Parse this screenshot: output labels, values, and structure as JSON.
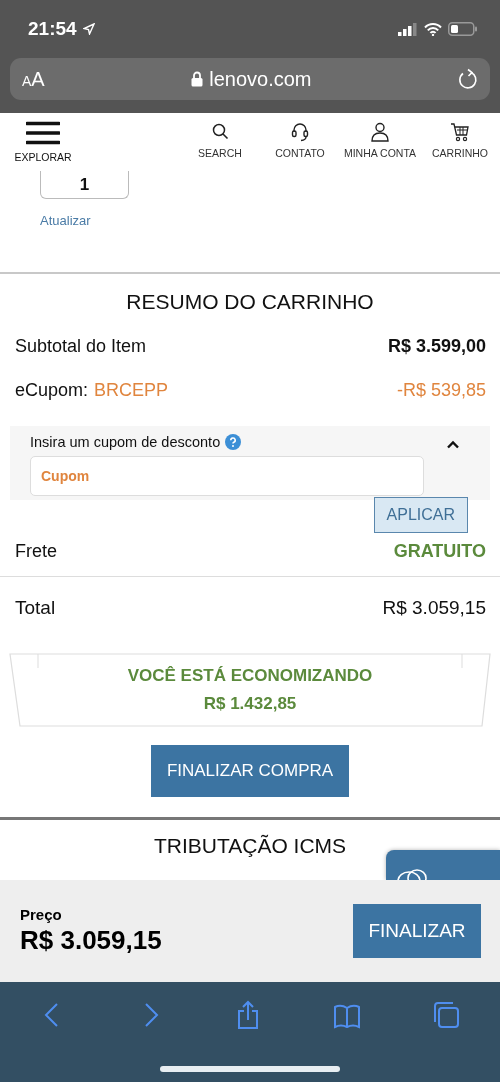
{
  "status_bar": {
    "time": "21:54"
  },
  "browser": {
    "text_size": "AA",
    "url": "lenovo.com"
  },
  "nav": {
    "menu_label": "EXPLORAR",
    "items": [
      {
        "label": "SEARCH"
      },
      {
        "label": "CONTATO"
      },
      {
        "label": "MINHA CONTA"
      },
      {
        "label": "CARRINHO"
      }
    ]
  },
  "quantity": {
    "value": "1",
    "update_link": "Atualizar"
  },
  "summary": {
    "title": "RESUMO DO CARRINHO",
    "subtotal": {
      "label": "Subtotal do Item",
      "value": "R$ 3.599,00"
    },
    "coupon": {
      "label": "eCupom:",
      "code": "BRCEPP",
      "value": "-R$ 539,85"
    },
    "coupon_form": {
      "label": "Insira um cupom de desconto",
      "expanded": true,
      "placeholder": "Cupom",
      "apply": "APLICAR"
    },
    "shipping": {
      "label": "Frete",
      "value": "GRATUITO"
    },
    "total": {
      "label": "Total",
      "value": "R$ 3.059,15"
    },
    "savings": {
      "title": "VOCÊ ESTÁ ECONOMIZANDO",
      "value": "R$ 1.432,85"
    },
    "checkout": "FINALIZAR COMPRA"
  },
  "tax_section": {
    "title": "TRIBUTAÇÃO ICMS"
  },
  "sticky_bar": {
    "price_label": "Preço",
    "price": "R$ 3.059,15",
    "button": "FINALIZAR"
  }
}
